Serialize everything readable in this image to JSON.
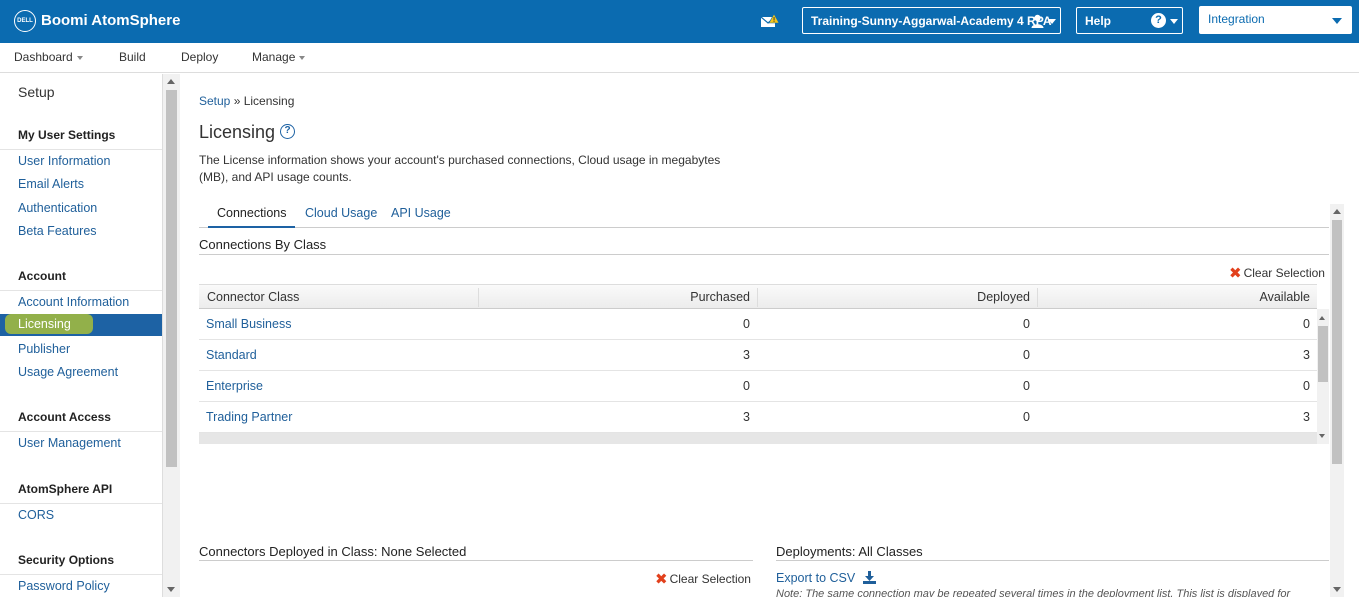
{
  "topbar": {
    "logo_text": "DELL",
    "app_title": "Boomi AtomSphere",
    "account_name": "Training-Sunny-Aggarwal-Academy 4 RPA",
    "help_label": "Help",
    "help_symbol": "?",
    "service_label": "Integration",
    "brand_color": "#0b6bb0"
  },
  "menu": {
    "items": [
      {
        "label": "Dashboard",
        "has_dropdown": true
      },
      {
        "label": "Build",
        "has_dropdown": false
      },
      {
        "label": "Deploy",
        "has_dropdown": false
      },
      {
        "label": "Manage",
        "has_dropdown": true
      }
    ]
  },
  "sidebar": {
    "title": "Setup",
    "sections": [
      {
        "heading": "My User Settings",
        "items": [
          "User Information",
          "Email Alerts",
          "Authentication",
          "Beta Features"
        ]
      },
      {
        "heading": "Account",
        "items": [
          "Account Information",
          "Licensing",
          "Publisher",
          "Usage Agreement"
        ]
      },
      {
        "heading": "Account Access",
        "items": [
          "User Management"
        ]
      },
      {
        "heading": "AtomSphere API",
        "items": [
          "CORS"
        ]
      },
      {
        "heading": "Security Options",
        "items": [
          "Password Policy"
        ]
      }
    ],
    "active_item": "Licensing"
  },
  "main": {
    "breadcrumb_root": "Setup",
    "breadcrumb_sep": " » ",
    "breadcrumb_current": "Licensing",
    "title": "Licensing",
    "help_symbol": "?",
    "description": "The License information shows your account's purchased connections, Cloud usage in megabytes (MB), and API usage counts.",
    "tabs": [
      {
        "label": "Connections",
        "active": true
      },
      {
        "label": "Cloud Usage",
        "active": false
      },
      {
        "label": "API Usage",
        "active": false
      }
    ],
    "section_title": "Connections By Class",
    "clear_selection_label": "Clear Selection",
    "grid": {
      "columns": [
        "Connector Class",
        "Purchased",
        "Deployed",
        "Available"
      ],
      "rows": [
        {
          "class": "Small Business",
          "purchased": "0",
          "deployed": "0",
          "available": "0"
        },
        {
          "class": "Standard",
          "purchased": "3",
          "deployed": "0",
          "available": "3"
        },
        {
          "class": "Enterprise",
          "purchased": "0",
          "deployed": "0",
          "available": "0"
        },
        {
          "class": "Trading Partner",
          "purchased": "3",
          "deployed": "0",
          "available": "3"
        }
      ]
    },
    "deployed_title": "Connectors Deployed in Class: None Selected",
    "deployments_title": "Deployments: All Classes",
    "export_label": "Export to CSV",
    "note": "Note: The same connection may be repeated several times in the deployment list. This list is displayed for"
  }
}
